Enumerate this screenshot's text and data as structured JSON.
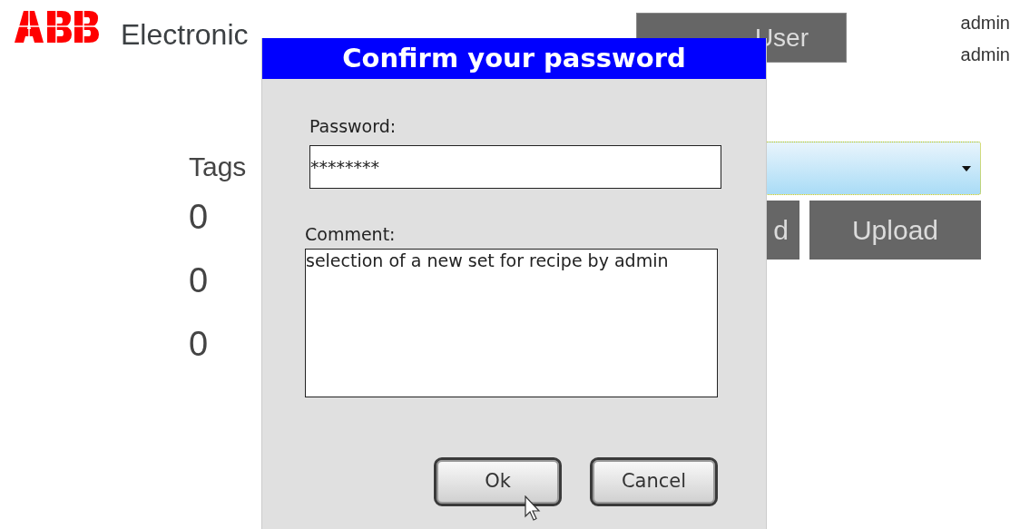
{
  "header": {
    "title": "Electronic",
    "switch_user_button": "User",
    "user_lines": [
      "admin",
      "admin"
    ]
  },
  "tags": {
    "label": "Tags",
    "values": [
      "0",
      "0",
      "0"
    ]
  },
  "buttons": [
    "d",
    "Upload"
  ],
  "dialog": {
    "title": "Confirm your password",
    "password": {
      "label": "Password:",
      "value": "********"
    },
    "comment": {
      "label": "Comment:",
      "value": "selection of a new set for recipe by admin"
    },
    "buttons": [
      "Ok",
      "Cancel"
    ]
  }
}
